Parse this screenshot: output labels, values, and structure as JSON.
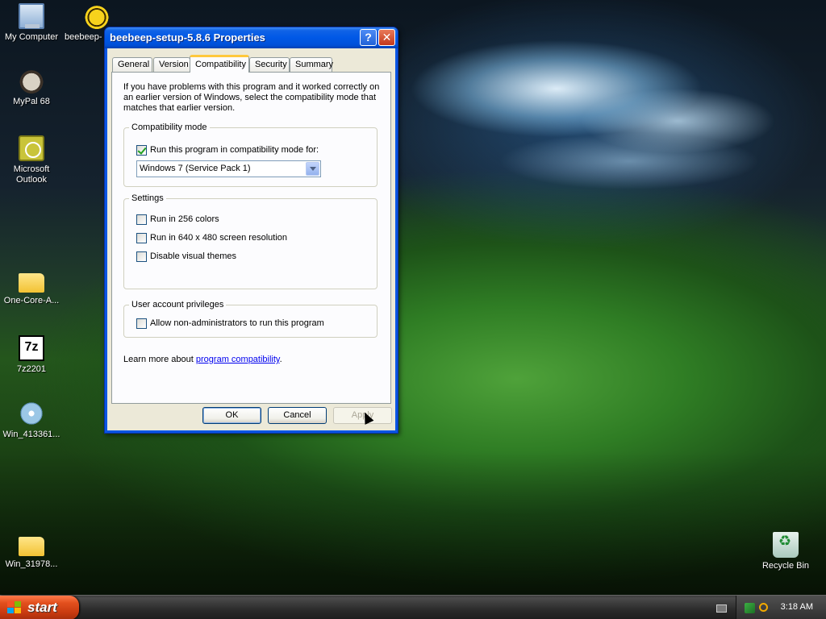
{
  "desktop": {
    "icons": [
      {
        "label": "My Computer"
      },
      {
        "label": "beebeep-"
      },
      {
        "label": "MyPal 68"
      },
      {
        "label": "Microsoft Outlook"
      },
      {
        "label": "One-Core-A..."
      },
      {
        "label": "7z2201"
      },
      {
        "label": "Win_413361..."
      },
      {
        "label": "Win_31978..."
      },
      {
        "label": "Recycle Bin"
      }
    ]
  },
  "window": {
    "title": "beebeep-setup-5.8.6 Properties",
    "help_glyph": "?",
    "close_glyph": "✕",
    "tabs": [
      {
        "label": "General"
      },
      {
        "label": "Version"
      },
      {
        "label": "Compatibility"
      },
      {
        "label": "Security"
      },
      {
        "label": "Summary"
      }
    ],
    "active_tab": "Compatibility",
    "intro": "If you have problems with this program and it worked correctly on an earlier version of Windows, select the compatibility mode that matches that earlier version.",
    "compat_group": {
      "legend": "Compatibility mode",
      "checkbox_label": "Run this program in compatibility mode for:",
      "checked": true,
      "selected_mode": "Windows 7 (Service Pack 1)"
    },
    "settings_group": {
      "legend": "Settings",
      "options": [
        {
          "label": "Run in 256 colors",
          "checked": false
        },
        {
          "label": "Run in 640 x 480 screen resolution",
          "checked": false
        },
        {
          "label": "Disable visual themes",
          "checked": false
        }
      ]
    },
    "privileges_group": {
      "legend": "User account privileges",
      "option": {
        "label": "Allow non-administrators to run this program",
        "checked": false
      }
    },
    "learn_more_prefix": "Learn more about ",
    "learn_more_link": "program compatibility",
    "learn_more_suffix": ".",
    "buttons": {
      "ok": "OK",
      "cancel": "Cancel",
      "apply": "Apply"
    }
  },
  "taskbar": {
    "start_label": "start",
    "clock": "3:18 AM"
  },
  "colors": {
    "titlebar": "#0058e6",
    "start_button": "#e2501e",
    "tab_highlight": "#ffc83c",
    "link": "#0000ee"
  }
}
